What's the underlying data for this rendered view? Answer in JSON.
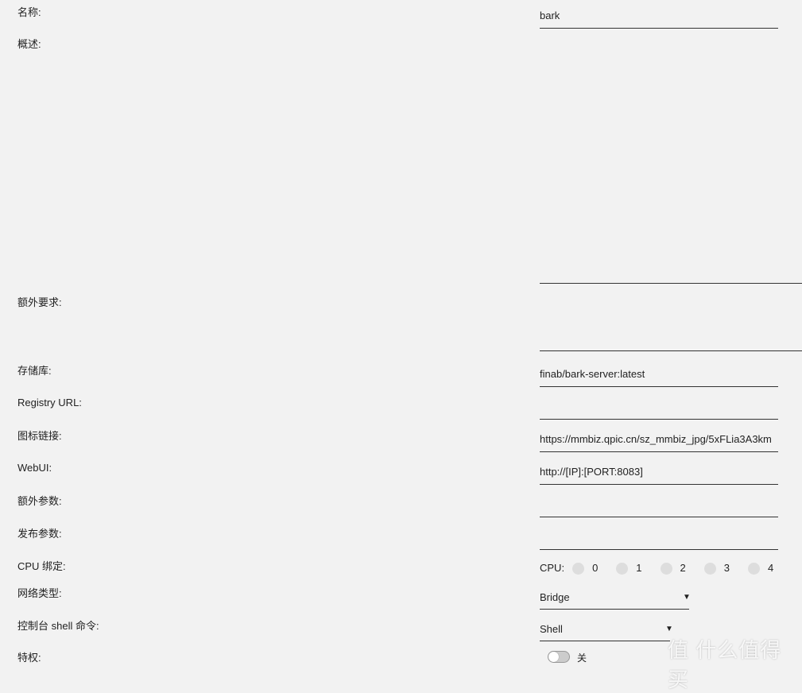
{
  "labels": {
    "name": "名称:",
    "description": "概述:",
    "extra_req": "额外要求:",
    "repo": "存储库:",
    "registry": "Registry URL:",
    "icon_link": "图标链接:",
    "webui": "WebUI:",
    "extra_params": "额外参数:",
    "publish_params": "发布参数:",
    "cpu_bind": "CPU 绑定:",
    "network_type": "网络类型:",
    "console_shell": "控制台 shell 命令:",
    "privileged": "特权:"
  },
  "fields": {
    "name": "bark",
    "description": "",
    "extra_req": "",
    "repo": "finab/bark-server:latest",
    "registry": "",
    "icon_link": "https://mmbiz.qpic.cn/sz_mmbiz_jpg/5xFLia3A3km",
    "webui": "http://[IP]:[PORT:8083]",
    "extra_params": "",
    "publish_params": ""
  },
  "cpu": {
    "label": "CPU:",
    "options": [
      "0",
      "1",
      "2",
      "3",
      "4"
    ]
  },
  "network_type": {
    "selected": "Bridge"
  },
  "console_shell": {
    "selected": "Shell"
  },
  "privileged": {
    "state": "关",
    "on": false
  },
  "watermark": "值 什么值得买"
}
